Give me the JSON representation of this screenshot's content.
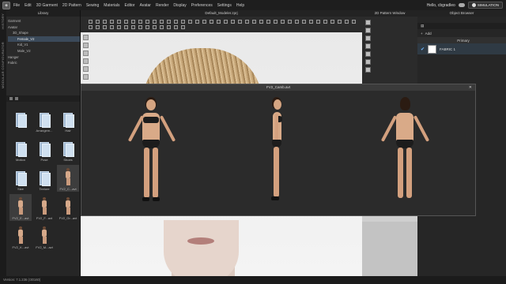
{
  "menu": {
    "items": [
      "File",
      "Edit",
      "3D Garment",
      "2D Pattern",
      "Sewing",
      "Materials",
      "Editor",
      "Avatar",
      "Render",
      "Display",
      "Preferences",
      "Settings",
      "Help"
    ],
    "user": "Hello, cbgradleo",
    "simulation_label": "SIMULATION"
  },
  "vertical_tabs": [
    "HISTORY",
    "MODULAR CONFIGURATOR"
  ],
  "library": {
    "title": "Library",
    "tree": [
      {
        "label": "Garment",
        "level": 0
      },
      {
        "label": "Avatar",
        "level": 0
      },
      {
        "label": "3D_Shape",
        "level": 1
      },
      {
        "label": "Female_V2",
        "level": 2,
        "selected": true
      },
      {
        "label": "Kid_V1",
        "level": 2
      },
      {
        "label": "Male_V2",
        "level": 2
      },
      {
        "label": "Hanger",
        "level": 0
      },
      {
        "label": "Fabric",
        "level": 0
      }
    ],
    "grid": [
      {
        "label": "",
        "kind": "folder"
      },
      {
        "label": "Arrangem...",
        "kind": "folder"
      },
      {
        "label": "Hair",
        "kind": "folder"
      },
      {
        "label": "Motion",
        "kind": "folder"
      },
      {
        "label": "Pose",
        "kind": "folder"
      },
      {
        "label": "Shoes",
        "kind": "folder"
      },
      {
        "label": "Size",
        "kind": "folder"
      },
      {
        "label": "Texture",
        "kind": "folder"
      },
      {
        "label": "FV2_C...avt",
        "kind": "avatar",
        "selected": true
      },
      {
        "label": "FV2_E...avt",
        "kind": "avatar",
        "selected": true
      },
      {
        "label": "FV2_F...avt",
        "kind": "avatar"
      },
      {
        "label": "FV2_Gr...avt",
        "kind": "avatar"
      },
      {
        "label": "FV2_K...avt",
        "kind": "avatar"
      },
      {
        "label": "FV2_M...avt",
        "kind": "avatar"
      }
    ]
  },
  "viewport": {
    "title": "Default_Modeler.zprj"
  },
  "pattern_window": {
    "title": "2D Pattern Window"
  },
  "object_browser": {
    "title": "Object Browser",
    "add_label": "Add",
    "section": "Primary",
    "fabric": "FABRIC 1"
  },
  "avatar_window": {
    "title": "FV2_Camb.avt"
  },
  "status": "Version: 7.1.236 (r30160)",
  "colors": {
    "accent": "#6fb6ff",
    "selection": "#3b4a5a"
  }
}
